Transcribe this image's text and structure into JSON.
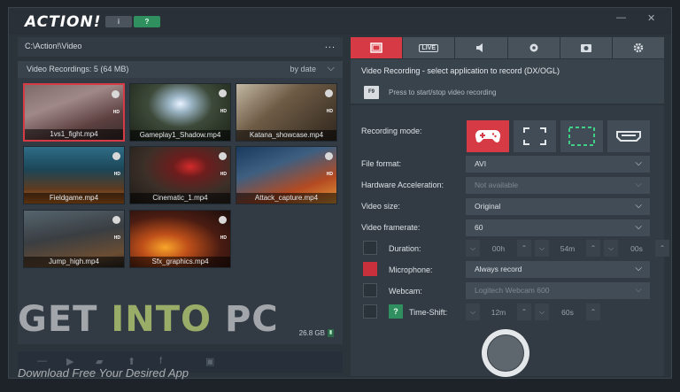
{
  "app": {
    "logo": "ACTION!",
    "info_btn": "i",
    "help_btn": "?"
  },
  "window_controls": {
    "minimize": "—",
    "close": "✕"
  },
  "left": {
    "path": "C:\\Action!\\Video",
    "path_more": "...",
    "library_title": "Video Recordings: 5 (64 MB)",
    "sort_label": "by date",
    "storage": "26.8 GB",
    "thumbnails": [
      {
        "name": "1vs1_fight.mp4",
        "selected": true
      },
      {
        "name": "Gameplay1_Shadow.mp4",
        "selected": false
      },
      {
        "name": "Katana_showcase.mp4",
        "selected": false
      },
      {
        "name": "Fieldgame.mp4",
        "selected": false
      },
      {
        "name": "Cinematic_1.mp4",
        "selected": false
      },
      {
        "name": "Attack_capture.mp4",
        "selected": false
      },
      {
        "name": "Jump_high.mp4",
        "selected": false
      },
      {
        "name": "Sfx_graphics.mp4",
        "selected": false
      }
    ],
    "thumb_badge": "HD"
  },
  "tabs": [
    {
      "icon": "video-record-icon",
      "label": ""
    },
    {
      "icon": "live-icon",
      "label": "LIVE"
    },
    {
      "icon": "speaker-icon",
      "label": ""
    },
    {
      "icon": "webcam-icon",
      "label": ""
    },
    {
      "icon": "screenshot-icon",
      "label": ""
    },
    {
      "icon": "gear-icon",
      "label": ""
    }
  ],
  "info": {
    "title": "Video Recording - select application to record (DX/OGL)",
    "key": "F9",
    "hint": "Press to start/stop video recording"
  },
  "settings": {
    "recording_mode_label": "Recording mode:",
    "file_format_label": "File format:",
    "file_format": "AVI",
    "hw_accel_label": "Hardware Acceleration:",
    "hw_accel": "Not available",
    "video_size_label": "Video size:",
    "video_size": "Original",
    "framerate_label": "Video framerate:",
    "framerate": "60",
    "duration_label": "Duration:",
    "duration_h": "00h",
    "duration_m": "54m",
    "duration_s": "00s",
    "microphone_label": "Microphone:",
    "microphone": "Always record",
    "webcam_label": "Webcam:",
    "webcam": "Logitech Webcam 600",
    "timeshift_label": "Time-Shift:",
    "timeshift_help": "?",
    "timeshift_m": "12m",
    "timeshift_s": "60s"
  },
  "watermark": {
    "get": "GET ",
    "into": "INTO",
    "pc": " PC",
    "sub": "Download Free Your Desired App"
  },
  "colors": {
    "accent": "#d63a44",
    "green": "#2f8f5e",
    "panel": "#323b44"
  }
}
